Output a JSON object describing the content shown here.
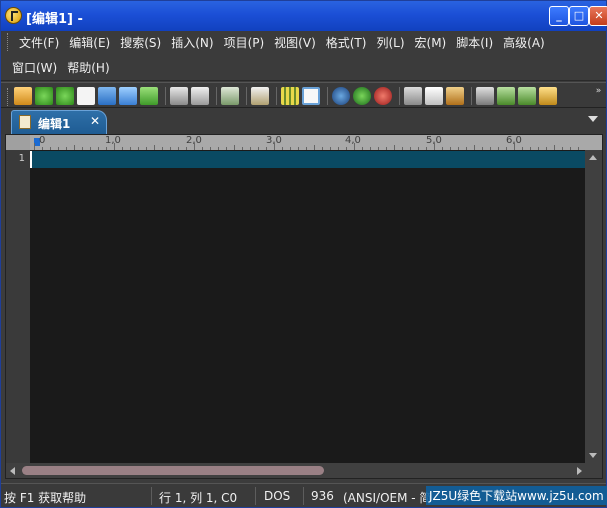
{
  "window": {
    "title": "[编辑1] -",
    "colors": {
      "titlebar": "#1b4fd6",
      "tab": "#1f5c93",
      "current_line": "#0a4a63",
      "editor_bg": "#1a1a1a"
    }
  },
  "controls": {
    "minimize": "_",
    "maximize": "□",
    "close": "✕"
  },
  "menu": {
    "row1": [
      "文件(F)",
      "编辑(E)",
      "搜索(S)",
      "插入(N)",
      "项目(P)",
      "视图(V)",
      "格式(T)",
      "列(L)",
      "宏(M)",
      "脚本(I)",
      "高级(A)"
    ],
    "row2": [
      "窗口(W)",
      "帮助(H)"
    ]
  },
  "toolbar": {
    "icons": [
      "new-project-icon",
      "back-icon",
      "forward-icon",
      "new-file-icon",
      "open-icon",
      "open-folder-icon",
      "save-icon",
      "print-icon",
      "print-preview-icon",
      "list-icon",
      "spell-icon",
      "column-icon",
      "wrap-icon",
      "compile-icon",
      "run-icon",
      "stop-icon",
      "cut-icon",
      "copy-icon",
      "paste-icon",
      "find-icon",
      "replace-icon",
      "goto-icon",
      "macro-icon"
    ],
    "overflow": "»"
  },
  "tabs": [
    {
      "label": "编辑1",
      "close": "✕"
    }
  ],
  "ruler": {
    "labels": [
      "0",
      "1,0",
      "2,0",
      "3,0",
      "4,0",
      "5,0",
      "6,0"
    ]
  },
  "editor": {
    "line_numbers": [
      "1"
    ]
  },
  "status": {
    "help": "按 F1 获取帮助",
    "position": "行 1, 列 1, C0",
    "line_ending": "DOS",
    "codepage": "936",
    "encoding": "(ANSI/OEM - 简",
    "watermark": "JZ5U绿色下载站www.jz5u.com"
  }
}
